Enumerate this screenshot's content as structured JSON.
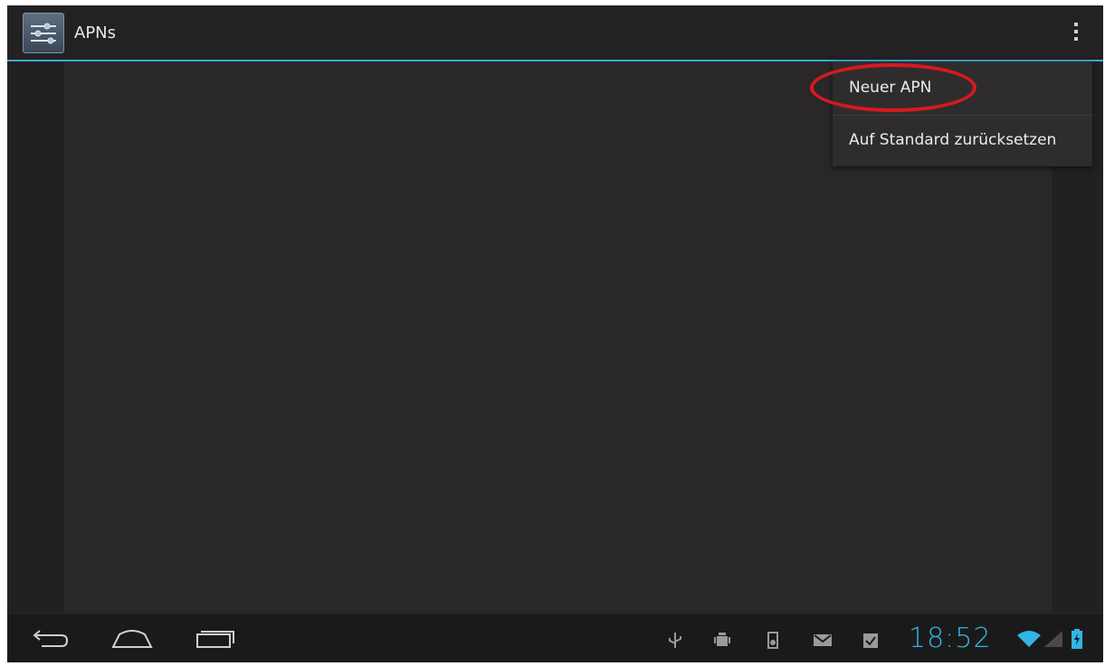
{
  "action_bar": {
    "title": "APNs",
    "app_icon": "settings-sliders-icon",
    "overflow_icon": "overflow-menu-icon"
  },
  "menu": {
    "items": [
      {
        "label": "Neuer APN"
      },
      {
        "label": "Auf Standard zurücksetzen"
      }
    ],
    "highlight_color": "#d8191f"
  },
  "system_bar": {
    "nav": [
      {
        "icon": "back-icon"
      },
      {
        "icon": "home-icon"
      },
      {
        "icon": "recent-apps-icon"
      }
    ],
    "notifications": [
      {
        "icon": "usb-icon"
      },
      {
        "icon": "android-debug-icon"
      },
      {
        "icon": "sd-card-icon"
      },
      {
        "icon": "email-icon"
      },
      {
        "icon": "clipboard-check-icon"
      }
    ],
    "clock": "18:52",
    "status": [
      {
        "icon": "wifi-icon"
      },
      {
        "icon": "signal-icon"
      },
      {
        "icon": "battery-icon"
      }
    ]
  },
  "colors": {
    "accent": "#33b5e5",
    "action_bar_divider": "#3aa8d8",
    "background": "#262325"
  }
}
